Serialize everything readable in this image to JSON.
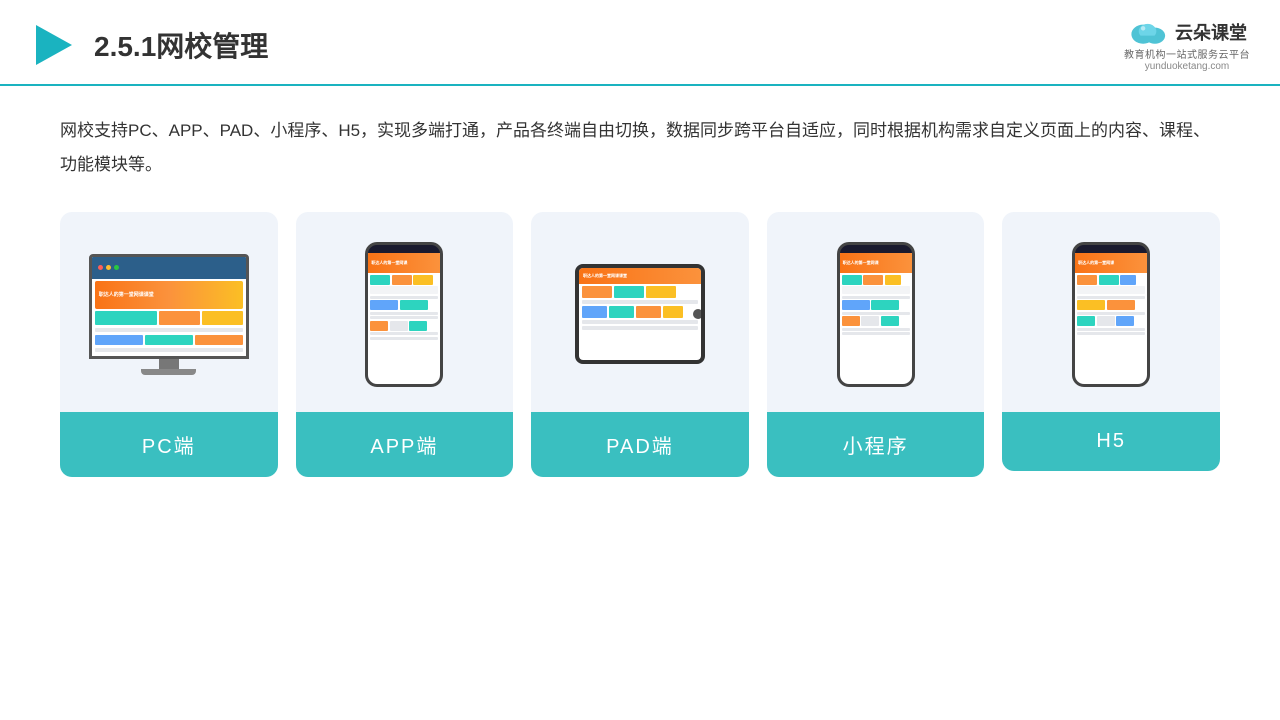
{
  "header": {
    "title": "2.5.1网校管理",
    "logo_name": "云朵课堂",
    "logo_url": "yunduoketang.com",
    "logo_tagline": "教育机构一站式服务云平台"
  },
  "description": "网校支持PC、APP、PAD、小程序、H5，实现多端打通，产品各终端自由切换，数据同步跨平台自适应，同时根据机构需求自定义页面上的内容、课程、功能模块等。",
  "devices": [
    {
      "id": "pc",
      "label": "PC端",
      "type": "pc"
    },
    {
      "id": "app",
      "label": "APP端",
      "type": "phone"
    },
    {
      "id": "pad",
      "label": "PAD端",
      "type": "tablet"
    },
    {
      "id": "miniapp",
      "label": "小程序",
      "type": "phone"
    },
    {
      "id": "h5",
      "label": "H5",
      "type": "phone"
    }
  ]
}
